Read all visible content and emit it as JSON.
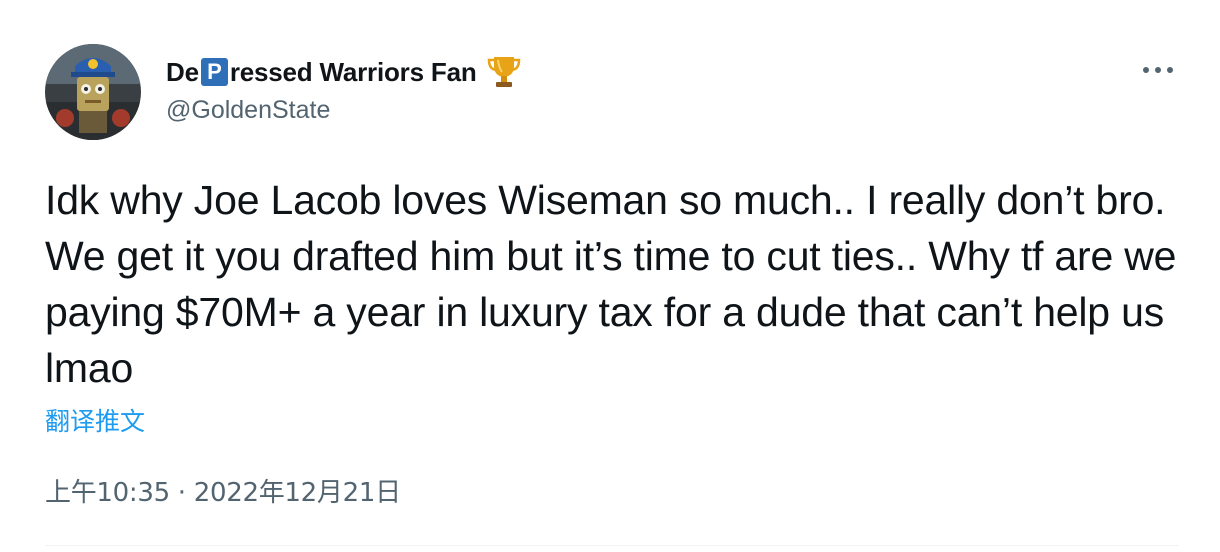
{
  "author": {
    "name_prefix": "De",
    "name_badge_letter": "P",
    "name_suffix": "ressed Warriors Fan",
    "badge_icon": "trophy-icon",
    "handle": "@GoldenState"
  },
  "tweet": {
    "text": "Idk why Joe Lacob loves Wiseman so much.. I really don’t bro. We get it you drafted him but it’s time to cut ties.. Why tf are we paying $70M+ a year in luxury tax for a dude that can’t help us lmao",
    "translate_label": "翻译推文",
    "time": "上午10:35",
    "separator": "·",
    "date": "2022年12月21日"
  },
  "colors": {
    "text_primary": "#0f1419",
    "text_secondary": "#536471",
    "link": "#1d9bf0",
    "badge_blue": "#2f6fb8"
  },
  "icons": {
    "more": "more-horizontal-icon",
    "avatar": "avatar-image"
  }
}
